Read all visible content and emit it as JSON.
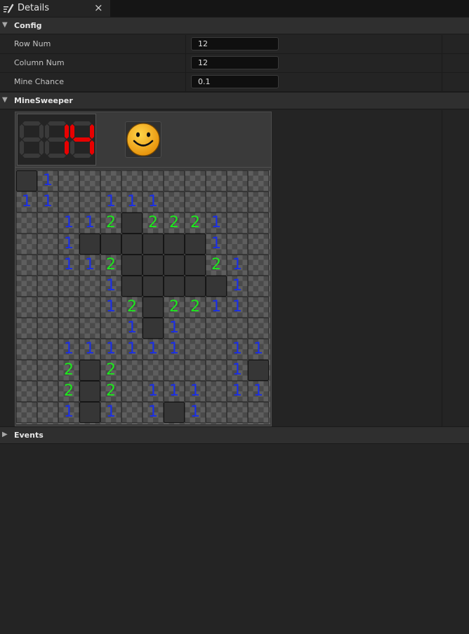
{
  "tab": {
    "title": "Details",
    "close": "×"
  },
  "config": {
    "header": "Config",
    "rows": [
      {
        "label": "Row Num",
        "value": "12"
      },
      {
        "label": "Column Num",
        "value": "12"
      },
      {
        "label": "Mine Chance",
        "value": "0.1"
      }
    ]
  },
  "minesweeper": {
    "header": "MineSweeper",
    "counter": "814",
    "counter_lit_digits": 2,
    "grid": [
      "#1..........",
      "11..111.....",
      "..112#2221..",
      "..1######1..",
      "..112####21.",
      "....1#####1.",
      "....12#2211.",
      ".....1#1....",
      "..111111..11",
      "..2#2.....1#",
      "..2#2.111.11",
      "..1#1.1#1..."
    ]
  },
  "events": {
    "header": "Events"
  },
  "icons": {
    "tab": "pencil-details-icon",
    "expanded": "triangle-down-icon",
    "collapsed": "triangle-right-icon",
    "smiley": "smiley-face-icon"
  },
  "colors": {
    "number_1": "#1a2ee8",
    "number_2": "#1ee81e",
    "counter_lit": "#e80000",
    "counter_dim": "#3a3a3a",
    "smiley": "#f5b01a"
  }
}
